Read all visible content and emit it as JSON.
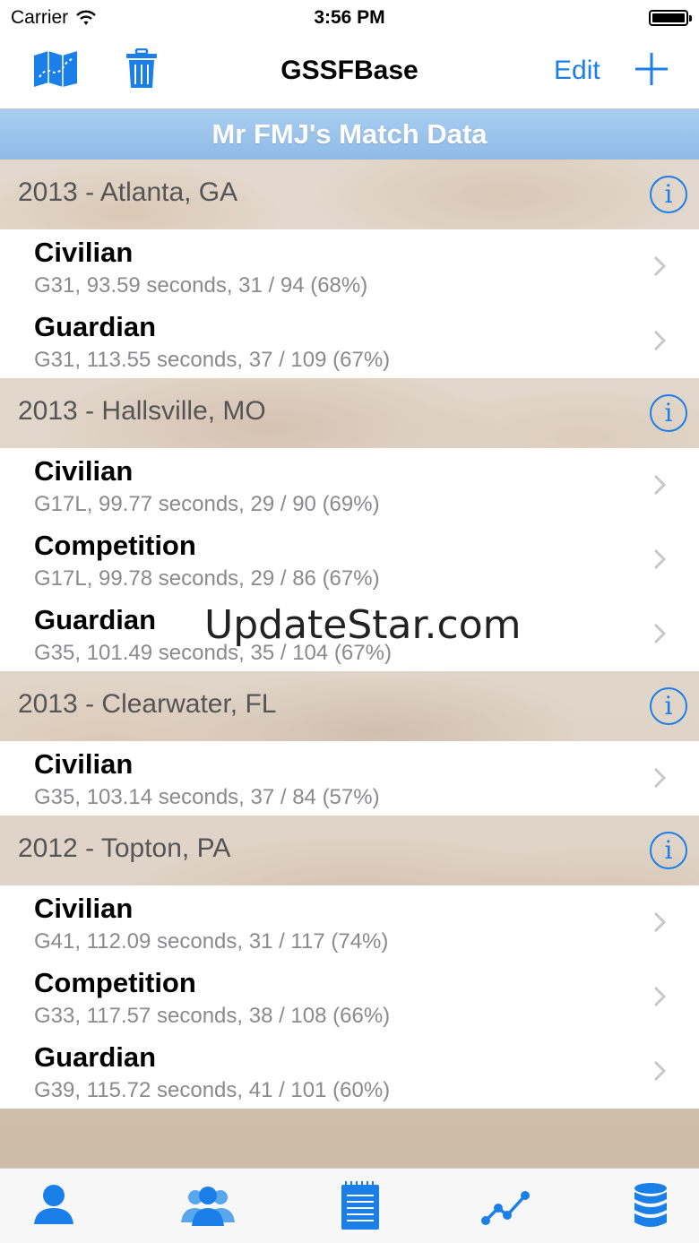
{
  "status_bar": {
    "carrier": "Carrier",
    "time": "3:56 PM"
  },
  "nav": {
    "title": "GSSFBase",
    "edit_label": "Edit"
  },
  "banner": {
    "title": "Mr FMJ's Match Data"
  },
  "sections": [
    {
      "title": "2013 - Atlanta, GA",
      "rows": [
        {
          "title": "Civilian",
          "subtitle": "G31, 93.59 seconds, 31 / 94 (68%)"
        },
        {
          "title": "Guardian",
          "subtitle": "G31, 113.55 seconds, 37 / 109 (67%)"
        }
      ]
    },
    {
      "title": "2013 - Hallsville, MO",
      "rows": [
        {
          "title": "Civilian",
          "subtitle": "G17L, 99.77 seconds, 29 / 90 (69%)"
        },
        {
          "title": "Competition",
          "subtitle": "G17L, 99.78 seconds, 29 / 86 (67%)"
        },
        {
          "title": "Guardian",
          "subtitle": "G35, 101.49 seconds, 35 / 104 (67%)"
        }
      ]
    },
    {
      "title": "2013 - Clearwater, FL",
      "rows": [
        {
          "title": "Civilian",
          "subtitle": "G35, 103.14 seconds, 37 / 84 (57%)"
        }
      ]
    },
    {
      "title": "2012 - Topton, PA",
      "rows": [
        {
          "title": "Civilian",
          "subtitle": "G41, 112.09 seconds, 31 / 117 (74%)"
        },
        {
          "title": "Competition",
          "subtitle": "G33, 117.57 seconds, 38 / 108 (66%)"
        },
        {
          "title": "Guardian",
          "subtitle": "G39, 115.72 seconds, 41 / 101 (60%)"
        }
      ]
    }
  ],
  "watermark": "UpdateStar.com",
  "tab_bar": {
    "tabs": [
      {
        "icon": "person-icon"
      },
      {
        "icon": "group-icon"
      },
      {
        "icon": "notepad-icon"
      },
      {
        "icon": "line-chart-icon"
      },
      {
        "icon": "database-icon"
      }
    ]
  },
  "colors": {
    "accent": "#1a7fe8",
    "banner": "#9cc4eb"
  }
}
